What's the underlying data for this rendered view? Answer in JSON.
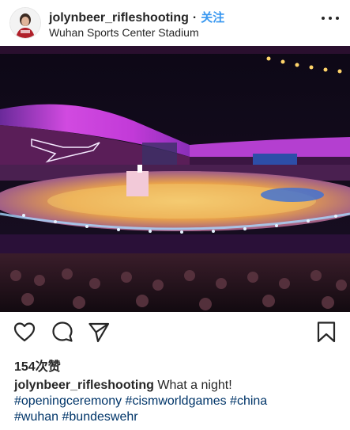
{
  "header": {
    "username": "jolynbeer_rifleshooting",
    "separator": "·",
    "follow_label": "关注",
    "location": "Wuhan Sports Center Stadium",
    "more_icon": "more-horizontal-icon"
  },
  "photo": {
    "alt_subject": "stadium-opening-ceremony",
    "colors": {
      "roof": "#c23ad8",
      "sky": "#0d0816",
      "floor": "#e9a24a"
    }
  },
  "actions": {
    "icons": [
      "heart-icon",
      "comment-icon",
      "share-icon",
      "bookmark-icon"
    ]
  },
  "likes": {
    "label": "154次赞"
  },
  "caption": {
    "username": "jolynbeer_rifleshooting",
    "text": "What a night!",
    "hashtags": [
      "#openingceremony",
      "#cismworldgames",
      "#china",
      "#wuhan",
      "#bundeswehr"
    ]
  }
}
